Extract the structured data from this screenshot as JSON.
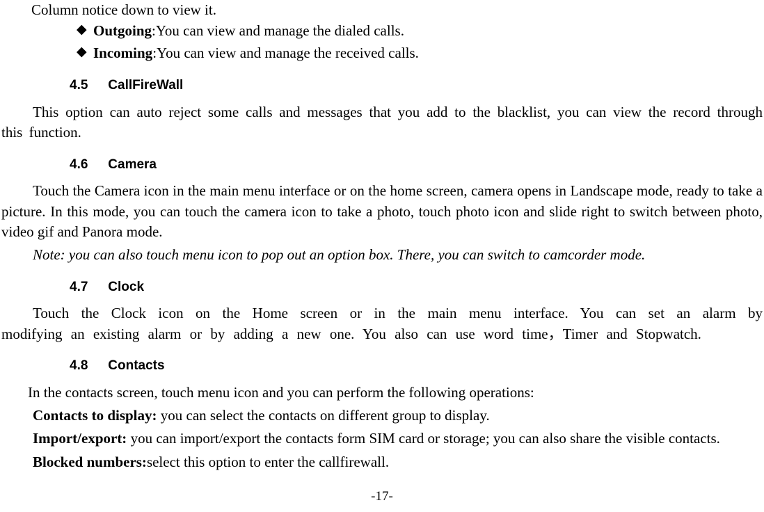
{
  "topLine": "Column notice down to view it.",
  "bullets": [
    {
      "label": "Outgoing",
      "desc": ":You can view and manage the dialed calls."
    },
    {
      "label": "Incoming",
      "desc": ":You can view and manage the received calls."
    }
  ],
  "bulletSym": "◆",
  "sec45": {
    "num": "4.5",
    "title": "CallFireWall",
    "para": "This option can auto reject some calls and messages that you add to the blacklist, you can view the record through this function."
  },
  "sec46": {
    "num": "4.6",
    "title": "Camera",
    "para": "Touch the Camera icon in the main menu interface or on the home screen, camera opens in Landscape mode, ready to take a picture. In this mode, you can touch the camera icon to take a photo, touch photo icon and slide right to switch between photo, video gif and Panora mode.",
    "note": "Note: you can also touch menu icon to pop out an option box. There, you can switch to camcorder mode."
  },
  "sec47": {
    "num": "4.7",
    "title": "Clock",
    "para": "Touch the Clock icon on the Home screen or in the main menu interface. You can set an alarm by modifying an existing alarm or by adding a new one. You also can use word time，Timer and Stopwatch."
  },
  "sec48": {
    "num": "4.8",
    "title": "Contacts",
    "intro": "In the contacts screen, touch menu icon and you can perform the following operations:",
    "itemA_label": "Contacts to display: ",
    "itemA_desc": "you can select the contacts on different group to display.",
    "itemB_label": "Import/export: ",
    "itemB_desc": "you can import/export the contacts form SIM card or storage; you can also share the visible contacts.",
    "itemC_label": "Blocked numbers:",
    "itemC_desc": "select this option to enter the callfirewall."
  },
  "pageNum": "-17-"
}
